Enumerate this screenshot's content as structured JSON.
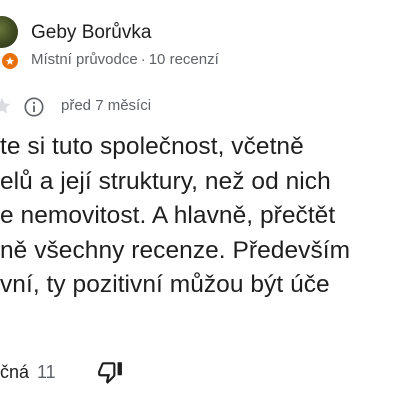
{
  "reviewer": {
    "name": "Geby Borůvka",
    "role": "Místní průvodce",
    "separator": "·",
    "review_count": "10 recenzí"
  },
  "review": {
    "date": "před 7 měsíci",
    "lines": [
      "te si tuto společnost, včetně",
      "elů a její struktury, než od nich",
      "e nemovitost. A hlavně, přečtět",
      "ně všechny recenze. Především",
      "vní, ty pozitivní můžou být úče"
    ]
  },
  "actions": {
    "helpful_label": "čná",
    "helpful_count": "11"
  },
  "icons": {
    "badge": "local-guide-star-icon",
    "rating": "star-icon",
    "info": "info-icon",
    "dislike": "thumbs-down-icon"
  },
  "colors": {
    "badge": "#e8710a",
    "muted_text": "#5f6368",
    "text": "#1f1f1f",
    "star_empty": "#dadce0"
  }
}
